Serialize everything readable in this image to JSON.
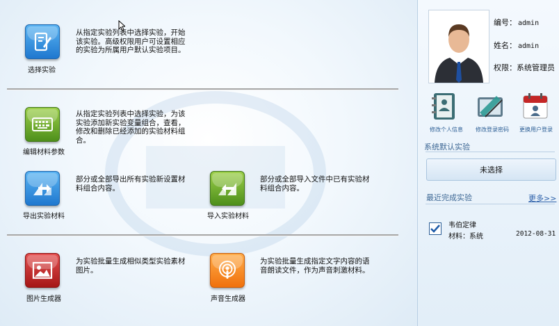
{
  "main": {
    "items": [
      {
        "label": "选择实验",
        "desc": "从指定实验列表中选择实验，开始该实验。高级权限用户可设置相应的实验为所属用户默认实验项目。",
        "icon": "book-pen-icon"
      },
      {
        "label": "编辑材料参数",
        "desc": "从指定实验列表中选择实验，为该实验添加新实验变量组合，查看，修改和删除已经添加的实验材料组合。",
        "icon": "keyboard-icon"
      },
      {
        "label": "导出实验材料",
        "desc": "部分或全部导出所有实验新设置材料组合内容。",
        "icon": "export-arrow-icon"
      },
      {
        "label": "导入实验材料",
        "desc": "部分或全部导入文件中已有实验材料组合内容。",
        "icon": "import-arrow-icon"
      },
      {
        "label": "图片生成器",
        "desc": "为实验批量生成相似类型实验素材图片。",
        "icon": "picture-icon"
      },
      {
        "label": "声音生成器",
        "desc": "为实验批量生成指定文字内容的语音朗读文件，作为声音刺激材料。",
        "icon": "podcast-icon"
      }
    ]
  },
  "user": {
    "id_label": "编号：",
    "id_value": "admin",
    "name_label": "姓名：",
    "name_value": "admin",
    "role_label": "权限：",
    "role_value": "系统管理员"
  },
  "actions": [
    {
      "label": "修改个人信息",
      "icon": "address-book-icon"
    },
    {
      "label": "修改登录密码",
      "icon": "password-tools-icon"
    },
    {
      "label": "更换用户登录",
      "icon": "calendar-user-icon"
    }
  ],
  "default_experiment": {
    "title": "系统默认实验",
    "value": "未选择"
  },
  "recent": {
    "title": "最近完成实验",
    "more": "更多>>",
    "item": {
      "name": "韦伯定律",
      "material": "材料：系统",
      "date": "2012-08-31"
    }
  },
  "colors": {
    "accent": "#2d5f96",
    "divider": "#a7a7a7"
  }
}
